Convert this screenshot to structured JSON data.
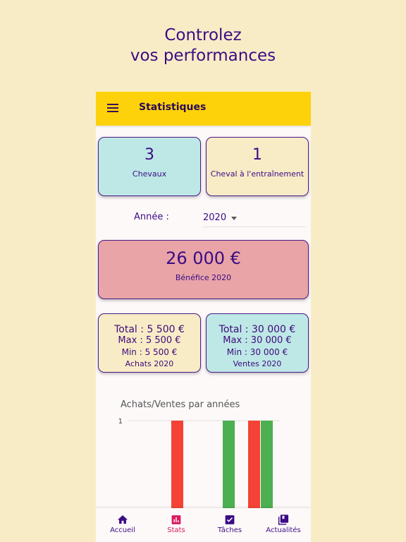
{
  "promo": {
    "line1": "Controlez",
    "line2": "vos performances"
  },
  "appbar": {
    "title": "Statistiques"
  },
  "stats": {
    "horses_count": "3",
    "horses_label": "Chevaux",
    "training_count": "1",
    "training_label": "Cheval à l'entraînement"
  },
  "year_filter": {
    "label": "Année :",
    "value": "2020"
  },
  "profit": {
    "value": "26 000 €",
    "label": "Bénéfice 2020"
  },
  "purchases": {
    "total": "Total : 5 500 €",
    "max": "Max : 5 500 €",
    "min": "Min : 5 500 €",
    "label": "Achats 2020"
  },
  "sales": {
    "total": "Total : 30 000 €",
    "max": "Max : 30 000 €",
    "min": "Min : 30 000 €",
    "label": "Ventes 2020"
  },
  "chart_data": {
    "type": "bar",
    "title": "Achats/Ventes par années",
    "ytick_labels": [
      "1"
    ],
    "ylim": [
      0,
      1
    ],
    "colors": {
      "achats": "#f44336",
      "ventes": "#4caf50"
    },
    "bars": [
      {
        "series": "achats",
        "value": 1
      },
      {
        "series": "ventes",
        "value": 1
      },
      {
        "series": "achats",
        "value": 1
      },
      {
        "series": "ventes",
        "value": 1
      }
    ]
  },
  "bottom_nav": {
    "items": [
      {
        "label": "Accueil",
        "icon": "home-icon"
      },
      {
        "label": "Stats",
        "icon": "bar-chart-icon"
      },
      {
        "label": "Tâches",
        "icon": "checkbox-icon"
      },
      {
        "label": "Actualités",
        "icon": "library-icon"
      }
    ],
    "active": "Stats",
    "active_color": "#d81b60"
  }
}
